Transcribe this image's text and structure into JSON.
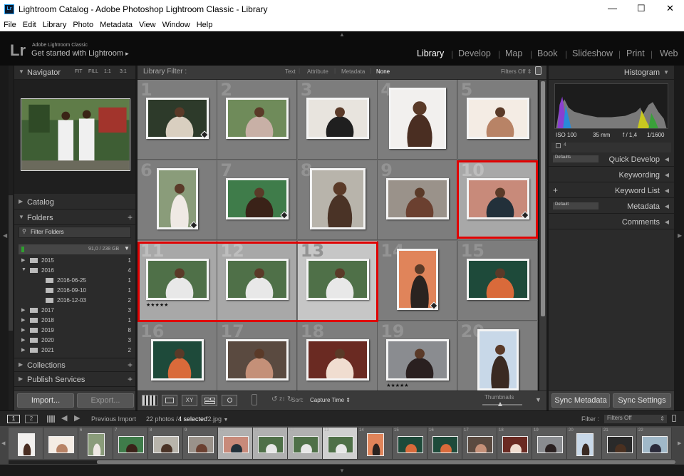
{
  "window": {
    "title": "Lightroom Catalog - Adobe Photoshop Lightroom Classic - Library",
    "controls": [
      "—",
      "☐",
      "✕"
    ]
  },
  "menu": [
    "File",
    "Edit",
    "Library",
    "Photo",
    "Metadata",
    "View",
    "Window",
    "Help"
  ],
  "identity": {
    "logo": "Lr",
    "line1": "Adobe Lightroom Classic",
    "line2": "Get started with Lightroom",
    "arrow": "▸"
  },
  "modules": [
    "Library",
    "Develop",
    "Map",
    "Book",
    "Slideshow",
    "Print",
    "Web"
  ],
  "active_module": "Library",
  "navigator": {
    "title": "Navigator",
    "zooms": [
      "FIT",
      "FILL",
      "1:1",
      "3:1"
    ]
  },
  "left_panels": {
    "catalog": "Catalog",
    "folders": "Folders",
    "filter_placeholder": "Filter Folders",
    "volume": "91,0 / 238 GB",
    "collections": "Collections",
    "publish": "Publish Services"
  },
  "folders": [
    {
      "name": "2015",
      "count": "1",
      "level": 0,
      "open": false
    },
    {
      "name": "2016",
      "count": "4",
      "level": 0,
      "open": true
    },
    {
      "name": "2016-06-25",
      "count": "1",
      "level": 1,
      "open": false
    },
    {
      "name": "2016-09-10",
      "count": "1",
      "level": 1,
      "open": false
    },
    {
      "name": "2016-12-03",
      "count": "2",
      "level": 1,
      "open": false
    },
    {
      "name": "2017",
      "count": "3",
      "level": 0,
      "open": false
    },
    {
      "name": "2018",
      "count": "1",
      "level": 0,
      "open": false
    },
    {
      "name": "2019",
      "count": "8",
      "level": 0,
      "open": false
    },
    {
      "name": "2020",
      "count": "3",
      "level": 0,
      "open": false
    },
    {
      "name": "2021",
      "count": "2",
      "level": 0,
      "open": false
    }
  ],
  "left_buttons": {
    "import": "Import...",
    "export": "Export..."
  },
  "filterbar": {
    "label": "Library Filter :",
    "tabs": [
      "Text",
      "Attribute",
      "Metadata",
      "None"
    ],
    "active": "None",
    "preset": "Filters Off"
  },
  "grid": [
    {
      "n": "1",
      "state": "",
      "colors": [
        "#2d3a2a",
        "#d9cfc0"
      ],
      "stars": "",
      "badge": true
    },
    {
      "n": "2",
      "state": "",
      "colors": [
        "#6f8b5a",
        "#c8b0a6"
      ],
      "stars": "",
      "badge": false
    },
    {
      "n": "3",
      "state": "",
      "colors": [
        "#e8e4de",
        "#1f1f1f"
      ],
      "stars": "",
      "badge": false
    },
    {
      "n": "4",
      "state": "",
      "colors": [
        "#f2f0ee",
        "#4a2e22"
      ],
      "stars": "",
      "badge": false
    },
    {
      "n": "5",
      "state": "",
      "colors": [
        "#f4ece4",
        "#b88366"
      ],
      "stars": "",
      "badge": false
    },
    {
      "n": "6",
      "state": "",
      "colors": [
        "#8a9c7a",
        "#efe9e4"
      ],
      "stars": "",
      "badge": true
    },
    {
      "n": "7",
      "state": "",
      "colors": [
        "#3f7c4a",
        "#3a2218"
      ],
      "stars": "",
      "badge": true
    },
    {
      "n": "8",
      "state": "",
      "colors": [
        "#b8b4ab",
        "#4a3326"
      ],
      "stars": "",
      "badge": false
    },
    {
      "n": "9",
      "state": "",
      "colors": [
        "#9a928a",
        "#6b4030"
      ],
      "stars": "",
      "badge": false
    },
    {
      "n": "10",
      "state": "sel",
      "colors": [
        "#c88a7a",
        "#22303a"
      ],
      "stars": "",
      "badge": true
    },
    {
      "n": "11",
      "state": "sel",
      "colors": [
        "#4f7048",
        "#e8e8e8"
      ],
      "stars": "★★★★★",
      "badge": false
    },
    {
      "n": "12",
      "state": "sel",
      "colors": [
        "#4f7048",
        "#e8e8e8"
      ],
      "stars": "",
      "badge": false
    },
    {
      "n": "13",
      "state": "sel2",
      "colors": [
        "#4f7048",
        "#e8e8e8"
      ],
      "stars": "",
      "badge": false
    },
    {
      "n": "14",
      "state": "",
      "colors": [
        "#e0845a",
        "#2a2320"
      ],
      "stars": "",
      "badge": true
    },
    {
      "n": "15",
      "state": "",
      "colors": [
        "#1e4a3a",
        "#d96a3a"
      ],
      "stars": "",
      "badge": false
    },
    {
      "n": "16",
      "state": "",
      "colors": [
        "#1e4a3a",
        "#d96a3a"
      ],
      "stars": "",
      "badge": false
    },
    {
      "n": "17",
      "state": "",
      "colors": [
        "#5a4a40",
        "#c49078"
      ],
      "stars": "",
      "badge": false
    },
    {
      "n": "18",
      "state": "",
      "colors": [
        "#6a2a22",
        "#f0ddd0"
      ],
      "stars": "",
      "badge": false
    },
    {
      "n": "19",
      "state": "",
      "colors": [
        "#8a8c90",
        "#2a2020"
      ],
      "stars": "★★★★★",
      "badge": false
    },
    {
      "n": "20",
      "state": "",
      "colors": [
        "#c8d8e8",
        "#3a2a22"
      ],
      "stars": "",
      "badge": false
    }
  ],
  "toolbar": {
    "sort_label": "Sort:",
    "sort_value": "Capture Time",
    "thumbnails": "Thumbnails"
  },
  "histogram": {
    "title": "Histogram",
    "iso": "ISO 100",
    "focal": "35 mm",
    "aperture": "f / 1,4",
    "shutter": "1/1600"
  },
  "right_panels": {
    "quick_develop": "Quick Develop",
    "quick_preset": "Defaults",
    "keywording": "Keywording",
    "keyword_list": "Keyword List",
    "metadata": "Metadata",
    "metadata_preset": "Default",
    "comments": "Comments"
  },
  "right_buttons": {
    "sync_metadata": "Sync Metadata",
    "sync_settings": "Sync Settings"
  },
  "filmbar": {
    "page1": "1",
    "page2": "2",
    "source": "Previous Import",
    "count": "22 photos /",
    "selected": "4 selected",
    "file": "/2.jpg",
    "filter_label": "Filter :",
    "filter_value": "Filters Off"
  },
  "film": [
    {
      "n": "",
      "state": "",
      "colors": [
        "#f2f0ee",
        "#4a2e22"
      ]
    },
    {
      "n": "",
      "state": "",
      "colors": [
        "#f4ece4",
        "#b88366"
      ]
    },
    {
      "n": "6",
      "state": "",
      "colors": [
        "#8a9c7a",
        "#efe9e4"
      ]
    },
    {
      "n": "7",
      "state": "",
      "colors": [
        "#3f7c4a",
        "#3a2218"
      ]
    },
    {
      "n": "8",
      "state": "",
      "colors": [
        "#b8b4ab",
        "#4a3326"
      ]
    },
    {
      "n": "9",
      "state": "",
      "colors": [
        "#9a928a",
        "#6b4030"
      ]
    },
    {
      "n": "10",
      "state": "sel",
      "colors": [
        "#c88a7a",
        "#22303a"
      ]
    },
    {
      "n": "11",
      "state": "sel",
      "colors": [
        "#4f7048",
        "#e8e8e8"
      ]
    },
    {
      "n": "12",
      "state": "sel",
      "colors": [
        "#4f7048",
        "#e8e8e8"
      ]
    },
    {
      "n": "13",
      "state": "sel2",
      "colors": [
        "#4f7048",
        "#e8e8e8"
      ]
    },
    {
      "n": "14",
      "state": "",
      "colors": [
        "#e0845a",
        "#2a2320"
      ]
    },
    {
      "n": "15",
      "state": "",
      "colors": [
        "#1e4a3a",
        "#d96a3a"
      ]
    },
    {
      "n": "16",
      "state": "",
      "colors": [
        "#1e4a3a",
        "#d96a3a"
      ]
    },
    {
      "n": "17",
      "state": "",
      "colors": [
        "#5a4a40",
        "#c49078"
      ]
    },
    {
      "n": "18",
      "state": "",
      "colors": [
        "#6a2a22",
        "#f0ddd0"
      ]
    },
    {
      "n": "19",
      "state": "",
      "colors": [
        "#8a8c90",
        "#2a2020"
      ]
    },
    {
      "n": "20",
      "state": "",
      "colors": [
        "#c8d8e8",
        "#3a2a22"
      ]
    },
    {
      "n": "21",
      "state": "",
      "colors": [
        "#2a2a2a",
        "#4a3020"
      ]
    },
    {
      "n": "22",
      "state": "",
      "colors": [
        "#a0b8c8",
        "#2a2a3a"
      ]
    }
  ],
  "colors": {
    "accent_red": "#e00000",
    "panel": "#2b2b2b",
    "grid_bg": "#6e6e6e"
  }
}
